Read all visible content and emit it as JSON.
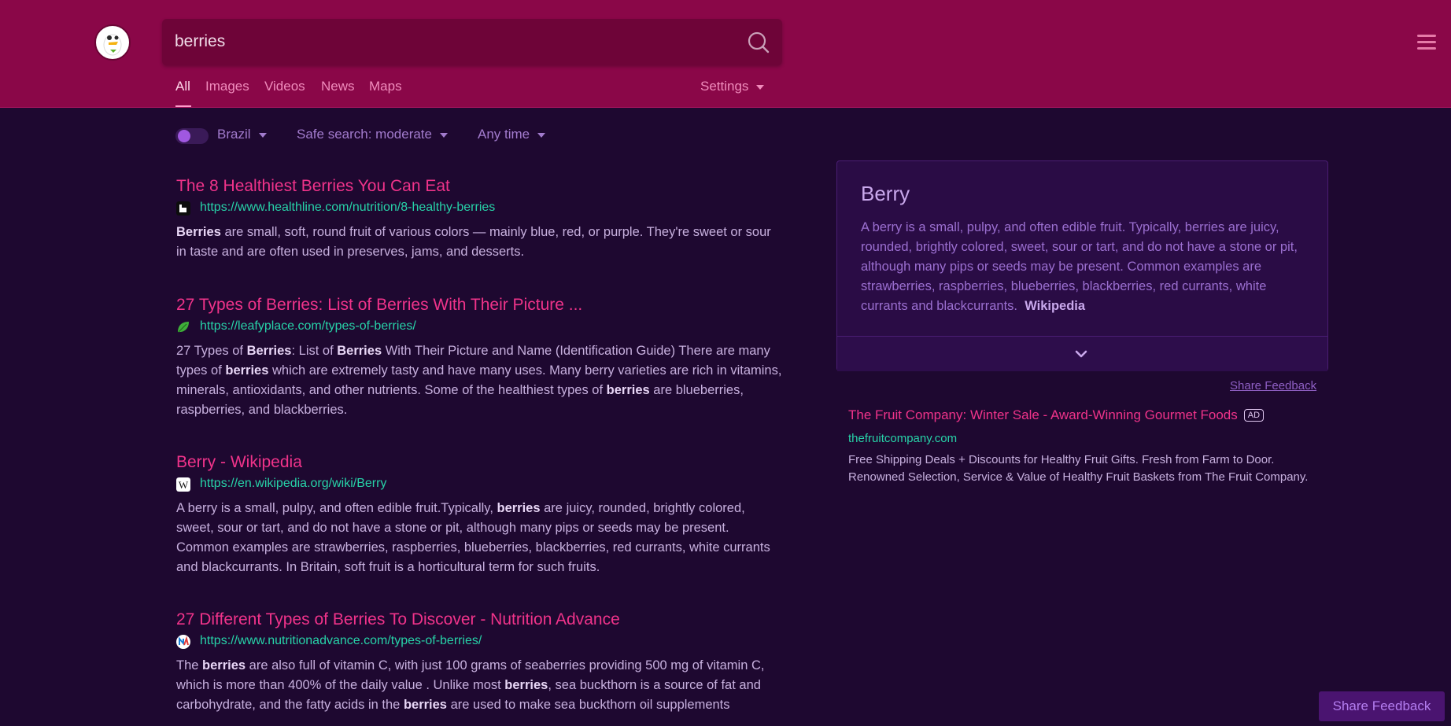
{
  "search": {
    "query": "berries"
  },
  "nav": {
    "tabs": [
      "All",
      "Images",
      "Videos",
      "News",
      "Maps"
    ],
    "settings_label": "Settings"
  },
  "filters": {
    "region": "Brazil",
    "safe_search": "Safe search: moderate",
    "time": "Any time"
  },
  "results": [
    {
      "title": "The 8 Healthiest Berries You Can Eat",
      "url": "https://www.healthline.com/nutrition/8-healthy-berries",
      "snippet_html": "<b>Berries</b> are small, soft, round fruit of various colors — mainly blue, red, or purple. They're sweet or sour in taste and are often used in preserves, jams, and desserts."
    },
    {
      "title": "27 Types of Berries: List of Berries With Their Picture ...",
      "url": "https://leafyplace.com/types-of-berries/",
      "snippet_html": "27 Types of <b>Berries</b>: List of <b>Berries</b> With Their Picture and Name (Identification Guide) There are many types of <b>berries</b> which are extremely tasty and have many uses. Many berry varieties are rich in vitamins, minerals, antioxidants, and other nutrients. Some of the healthiest types of <b>berries</b> are blueberries, raspberries, and blackberries."
    },
    {
      "title": "Berry - Wikipedia",
      "url": "https://en.wikipedia.org/wiki/Berry",
      "snippet_html": "A berry is a small, pulpy, and often edible fruit.Typically, <b>berries</b> are juicy, rounded, brightly colored, sweet, sour or tart, and do not have a stone or pit, although many pips or seeds may be present. Common examples are strawberries, raspberries, blueberries, blackberries, red currants, white currants and blackcurrants. In Britain, soft fruit is a horticultural term for such fruits."
    },
    {
      "title": "27 Different Types of Berries To Discover - Nutrition Advance",
      "url": "https://www.nutritionadvance.com/types-of-berries/",
      "snippet_html": "The <b>berries</b> are also full of vitamin C, with just 100 grams of seaberries providing 500 mg of vitamin C, which is more than 400% of the daily value . Unlike most <b>berries</b>, sea buckthorn is a source of fat and carbohydrate, and the fatty acids in the <b>berries</b> are used to make sea buckthorn oil supplements"
    }
  ],
  "infobox": {
    "title": "Berry",
    "text": "A berry is a small, pulpy, and often edible fruit. Typically, berries are juicy, rounded, brightly colored, sweet, sour or tart, and do not have a stone or pit, although many pips or seeds may be present. Common examples are strawberries, raspberries, blueberries, blackberries, red currants, white currants and blackcurrants.",
    "source": "Wikipedia"
  },
  "feedback_link": "Share Feedback",
  "ad": {
    "title": "The Fruit Company: Winter Sale - Award-Winning Gourmet Foods",
    "badge": "AD",
    "url": "thefruitcompany.com",
    "text": "Free Shipping Deals + Discounts for Healthy Fruit Gifts. Fresh from Farm to Door. Renowned Selection, Service & Value of Healthy Fruit Baskets from The Fruit Company."
  },
  "share_button": "Share Feedback",
  "colors": {
    "header": "#8a0748",
    "background": "#1e0830",
    "result_title": "#f0338a",
    "result_url": "#27d2a8"
  }
}
